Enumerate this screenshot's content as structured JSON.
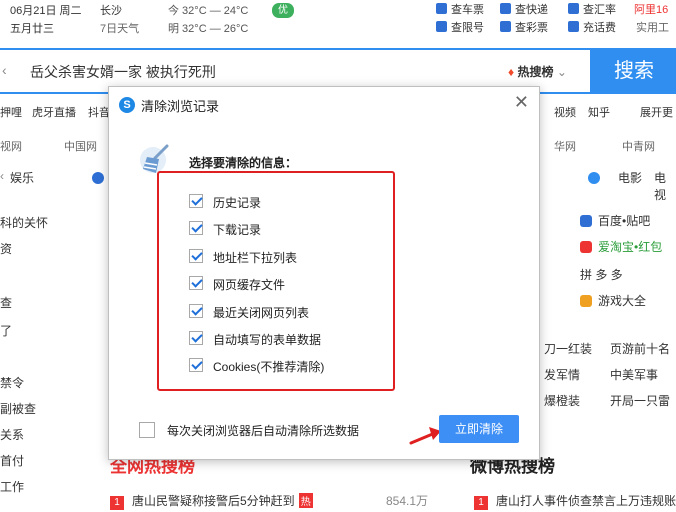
{
  "topbar": {
    "date": "06月21日 周二",
    "lunar": "五月廿三",
    "city": "长沙",
    "forecast_link": "7日天气",
    "weather_today": "今 32°C — 24°C",
    "weather_tomorrow": "明 32°C — 26°C",
    "air_quality": "优",
    "quick_links_row1": [
      "查车票",
      "查快递",
      "查汇率",
      "阿里16"
    ],
    "quick_links_row2": [
      "查限号",
      "查彩票",
      "充话费",
      "实用工"
    ]
  },
  "search": {
    "query": "岳父杀害女婿一家 被执行死刑",
    "hot_tag": "热搜榜",
    "button_label": "搜索"
  },
  "nav_links": [
    "押哩",
    "虎牙直播",
    "抖音",
    "视频",
    "知乎",
    "展开更"
  ],
  "site_links": [
    "视网",
    "中国网",
    "华网",
    "中青网"
  ],
  "categories": [
    "娱乐",
    "电影",
    "电视"
  ],
  "left_items": [
    "科的关怀",
    "资",
    "查",
    "了",
    "禁令",
    "副被查",
    "关系",
    "首付",
    "工作"
  ],
  "right_items": [
    "百度•贴吧",
    "爱淘宝•红包",
    "拼 多 多",
    "游戏大全"
  ],
  "right_news": [
    [
      "刀一红装",
      "页游前十名"
    ],
    [
      "发军情",
      "中美军事"
    ],
    [
      "爆橙装",
      "开局一只雷"
    ]
  ],
  "hot_sections": {
    "quanwang": "全网热搜榜",
    "weibo": "微博热搜榜"
  },
  "hot_rows": [
    {
      "rank": "1",
      "title": "唐山民警疑称接警后5分钟赶到",
      "badge": "热",
      "count": "854.1万"
    },
    {
      "rank": "1",
      "title": "唐山打人事件侦查禁言上万违规账"
    }
  ],
  "dialog": {
    "title": "清除浏览记录",
    "heading": "选择要清除的信息：",
    "options": [
      {
        "label": "历史记录",
        "checked": true
      },
      {
        "label": "下载记录",
        "checked": true
      },
      {
        "label": "地址栏下拉列表",
        "checked": true
      },
      {
        "label": "网页缓存文件",
        "checked": true
      },
      {
        "label": "最近关闭网页列表",
        "checked": true
      },
      {
        "label": "自动填写的表单数据",
        "checked": true
      },
      {
        "label": "Cookies(不推荐清除)",
        "checked": true
      }
    ],
    "auto_clear": {
      "label": "每次关闭浏览器后自动清除所选数据",
      "checked": false
    },
    "clear_button": "立即清除"
  },
  "colors": {
    "brand_blue": "#2f8ef0",
    "button_blue": "#3d8ff5",
    "highlight_red": "#e02020",
    "good_green": "#3cb05c"
  }
}
